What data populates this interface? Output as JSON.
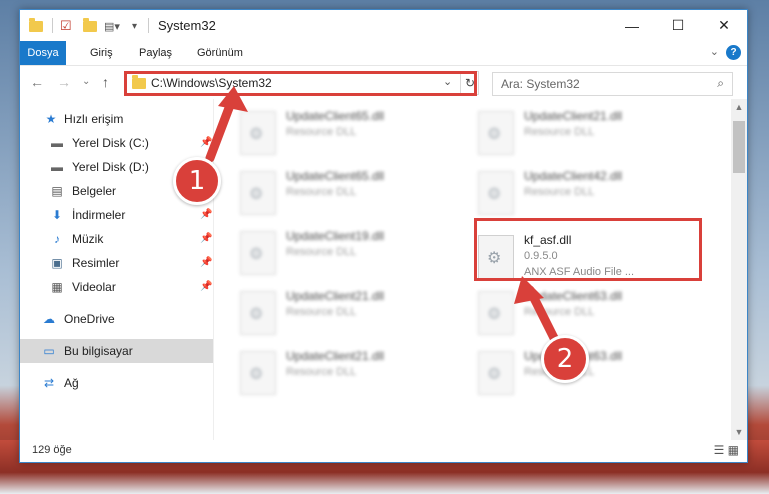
{
  "window": {
    "title": "System32",
    "minimize_icon": "—",
    "maximize_icon": "☐",
    "close_icon": "✕"
  },
  "ribbon": {
    "tabs": [
      "Dosya",
      "Giriş",
      "Paylaş",
      "Görünüm"
    ],
    "expand_icon": "⌄",
    "help": "?"
  },
  "address": {
    "path": "C:\\Windows\\System32",
    "dropdown_icon": "⌄",
    "refresh_icon": "↻"
  },
  "search": {
    "placeholder": "Ara: System32",
    "icon": "⌕"
  },
  "nav": {
    "back": "←",
    "forward": "→",
    "recent": "⌄",
    "up": "↑"
  },
  "sidebar": {
    "items": [
      {
        "label": "Hızlı erişim",
        "icon": "★"
      },
      {
        "label": "Yerel Disk (C:)",
        "icon": "▬"
      },
      {
        "label": "Yerel Disk (D:)",
        "icon": "▬"
      },
      {
        "label": "Belgeler",
        "icon": "▤"
      },
      {
        "label": "İndirmeler",
        "icon": "⬇"
      },
      {
        "label": "Müzik",
        "icon": "♪"
      },
      {
        "label": "Resimler",
        "icon": "▣"
      },
      {
        "label": "Videolar",
        "icon": "▦"
      },
      {
        "label": "OneDrive",
        "icon": "☁"
      },
      {
        "label": "Bu bilgisayar",
        "icon": "▭"
      },
      {
        "label": "Ağ",
        "icon": "⇄"
      }
    ],
    "pin": "📌"
  },
  "files": [
    {
      "name": "UpdateClient65.dll",
      "type": "Resource DLL"
    },
    {
      "name": "UpdateClient21.dll",
      "type": "Resource DLL"
    },
    {
      "name": "UpdateClient65.dll",
      "type": "Resource DLL"
    },
    {
      "name": "UpdateClient42.dll",
      "type": "Resource DLL"
    },
    {
      "name": "UpdateClient19.dll",
      "type": "Resource DLL"
    },
    {
      "name": "kf_asf.dll",
      "version": "0.9.5.0",
      "type": "ANX ASF Audio File ..."
    },
    {
      "name": "UpdateClient21.dll",
      "type": "Resource DLL"
    },
    {
      "name": "UpdateClient63.dll",
      "type": "Resource DLL"
    },
    {
      "name": "UpdateClient21.dll",
      "type": "Resource DLL"
    },
    {
      "name": "UpdateClient63.dll",
      "type": "Resource DLL"
    }
  ],
  "status": {
    "count": "129 öğe",
    "view_icons": "☰ ▦"
  },
  "annotations": {
    "badge1": "1",
    "badge2": "2",
    "color": "#d9403a"
  }
}
